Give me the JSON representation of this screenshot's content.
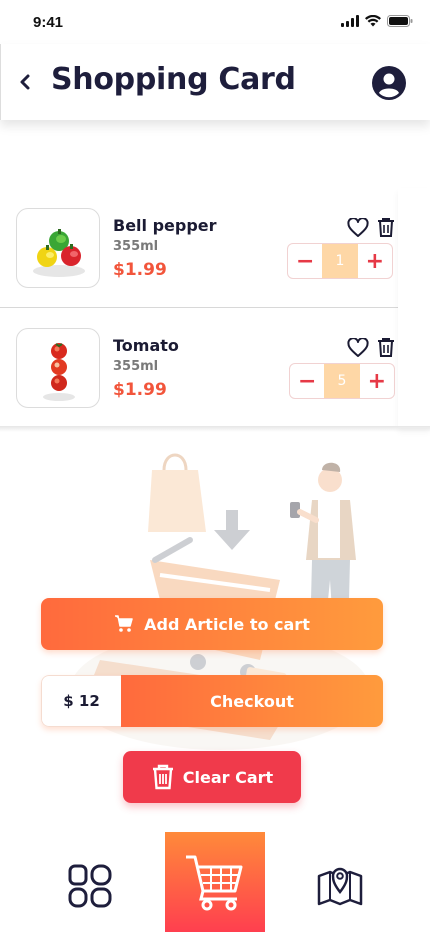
{
  "status_bar": {
    "time": "9:41"
  },
  "header": {
    "title": "Shopping Card"
  },
  "items": [
    {
      "name": "Bell pepper",
      "size": "355ml",
      "price": "$1.99",
      "quantity": "1"
    },
    {
      "name": "Tomato",
      "size": "355ml",
      "price": "$1.99",
      "quantity": "5"
    }
  ],
  "actions": {
    "add_label": "Add Article to cart",
    "total": "$ 12",
    "checkout_label": "Checkout",
    "clear_label": "Clear Cart"
  },
  "stepper": {
    "minus": "−",
    "plus": "+"
  },
  "icons": {
    "status": [
      "signal-icon",
      "wifi-icon",
      "battery-icon"
    ],
    "header": [
      "back-icon",
      "user-avatar-icon"
    ],
    "item": [
      "heart-icon",
      "trash-icon"
    ],
    "nav": [
      "categories-icon",
      "shopping-cart-icon",
      "map-icon"
    ]
  },
  "colors": {
    "accent_orange": "#ff6a3d",
    "accent_orange_end": "#ff9b3d",
    "price_red": "#f2553b",
    "clear_red": "#f03a4b",
    "dark_text": "#1e1e3c",
    "stepper_fill": "#fed7a6"
  }
}
